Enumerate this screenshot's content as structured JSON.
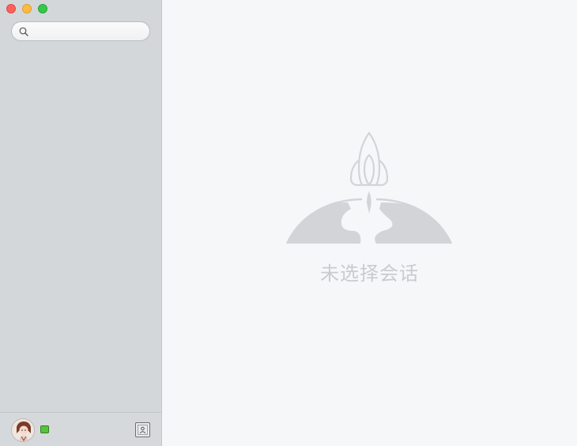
{
  "window": {
    "controls": [
      "close",
      "minimize",
      "zoom"
    ]
  },
  "sidebar": {
    "search": {
      "placeholder": "",
      "value": "",
      "icon": "search-icon"
    },
    "conversations": [],
    "footer": {
      "avatar_icon": "user-avatar",
      "status_color": "#58c23c",
      "contacts_icon": "contacts-icon"
    }
  },
  "main": {
    "empty_state": {
      "illustration": "rocket-over-globe-icon",
      "message": "未选择会话"
    }
  },
  "colors": {
    "sidebar_bg": "#d4d7d9",
    "main_bg": "#f6f7f9",
    "placeholder_gray": "#c9cbcf",
    "close": "#fc605c",
    "minimize": "#fdbc40",
    "zoom": "#34c84a"
  }
}
